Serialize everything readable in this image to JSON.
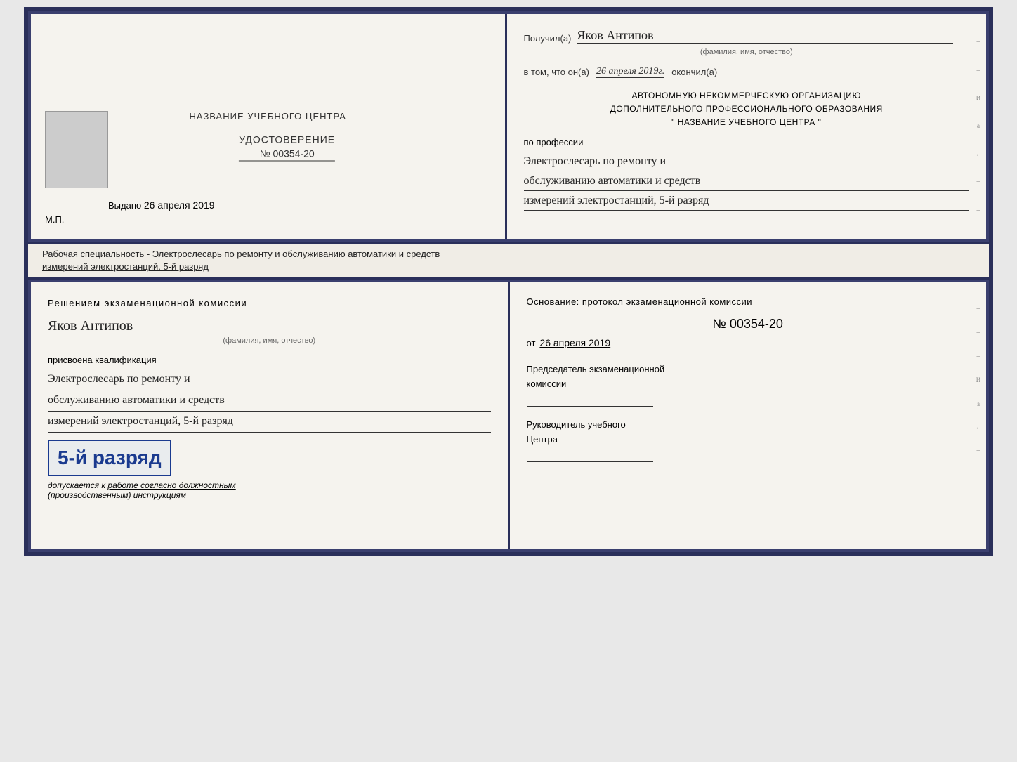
{
  "top_cert": {
    "left": {
      "title": "НАЗВАНИЕ УЧЕБНОГО ЦЕНТРА",
      "photo_alt": "photo",
      "udost_label": "УДОСТОВЕРЕНИЕ",
      "number": "№ 00354-20",
      "issued_label": "Выдано",
      "issued_date": "26 апреля 2019",
      "mp_label": "М.П."
    },
    "right": {
      "received_label": "Получил(а)",
      "person_name": "Яков Антипов",
      "fio_sub": "(фамилия, имя, отчество)",
      "in_that_label": "в том, что он(а)",
      "date_handwritten": "26 апреля 2019г.",
      "finished_label": "окончил(а)",
      "org_line1": "АВТОНОМНУЮ НЕКОММЕРЧЕСКУЮ ОРГАНИЗАЦИЮ",
      "org_line2": "ДОПОЛНИТЕЛЬНОГО ПРОФЕССИОНАЛЬНОГО ОБРАЗОВАНИЯ",
      "org_line3": "\"  НАЗВАНИЕ УЧЕБНОГО ЦЕНТРА  \"",
      "profession_label": "по профессии",
      "profession_line1": "Электрослесарь по ремонту и",
      "profession_line2": "обслуживанию автоматики и средств",
      "profession_line3": "измерений электростанций, 5-й разряд"
    }
  },
  "separator": {
    "text_line1": "Рабочая специальность - Электрослесарь по ремонту и обслуживанию автоматики и средств",
    "text_line2": "измерений электростанций, 5-й разряд"
  },
  "bottom_cert": {
    "left": {
      "decision_line1": "Решением  экзаменационной  комиссии",
      "person_name": "Яков Антипов",
      "fio_sub": "(фамилия, имя, отчество)",
      "kvalif_label": "присвоена квалификация",
      "profession_line1": "Электрослесарь по ремонту и",
      "profession_line2": "обслуживанию автоматики и средств",
      "profession_line3": "измерений электростанций, 5-й разряд",
      "stamp_text": "5-й разряд",
      "dopusk_prefix": "допускается к",
      "dopusk_underline": "работе согласно должностным",
      "dopusk_paren": "(производственным) инструкциям"
    },
    "right": {
      "osnov_label": "Основание:  протокол  экзаменационной  комиссии",
      "number": "№  00354-20",
      "ot_label": "от",
      "ot_date": "26 апреля 2019",
      "predsed_line1": "Председатель экзаменационной",
      "predsed_line2": "комиссии",
      "ruk_line1": "Руководитель учебного",
      "ruk_line2": "Центра"
    }
  }
}
